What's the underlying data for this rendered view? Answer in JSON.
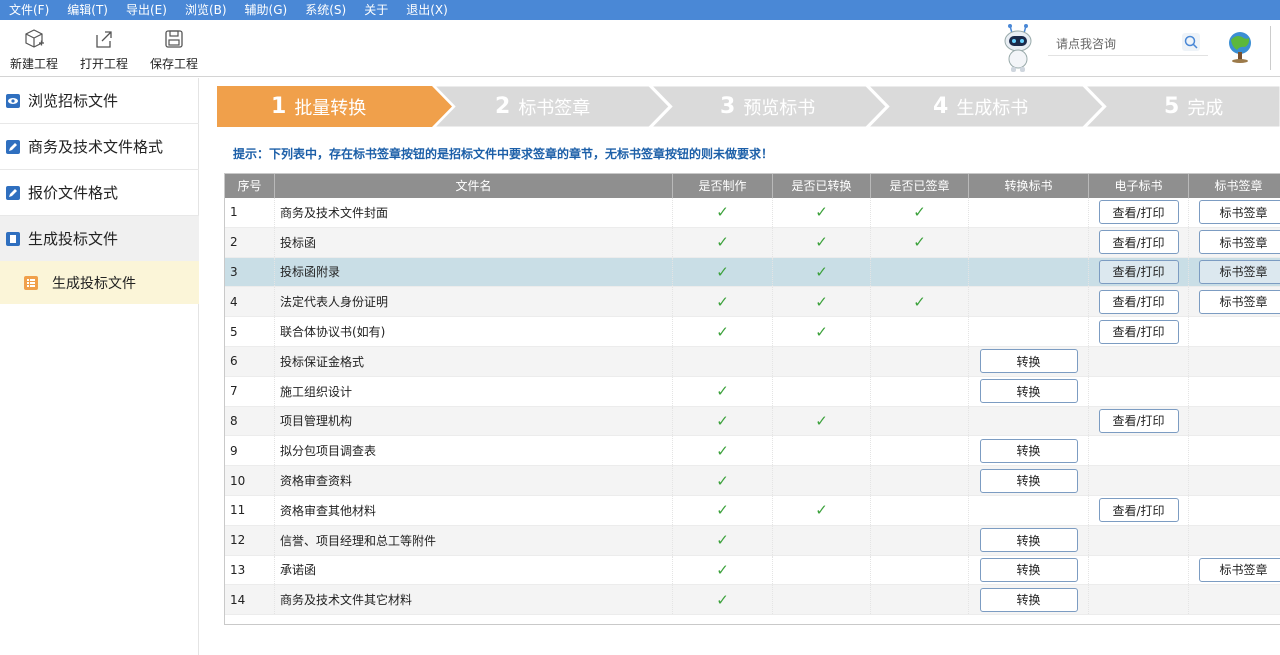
{
  "menu": [
    "文件(F)",
    "编辑(T)",
    "导出(E)",
    "浏览(B)",
    "辅助(G)",
    "系统(S)",
    "关于",
    "退出(X)"
  ],
  "toolbar": {
    "new": "新建工程",
    "open": "打开工程",
    "save": "保存工程"
  },
  "consult": {
    "placeholder": "请点我咨询"
  },
  "sidebar": {
    "items": [
      "浏览招标文件",
      "商务及技术文件格式",
      "报价文件格式",
      "生成投标文件"
    ],
    "sub": "生成投标文件"
  },
  "steps": [
    {
      "num": "1",
      "label": "批量转换"
    },
    {
      "num": "2",
      "label": "标书签章"
    },
    {
      "num": "3",
      "label": "预览标书"
    },
    {
      "num": "4",
      "label": "生成标书"
    },
    {
      "num": "5",
      "label": "完成"
    }
  ],
  "hint": "提示：下列表中，存在标书签章按钮的是招标文件中要求签章的章节，无标书签章按钮的则未做要求！",
  "table": {
    "headers": [
      "序号",
      "文件名",
      "是否制作",
      "是否已转换",
      "是否已签章",
      "转换标书",
      "电子标书",
      "标书签章"
    ],
    "buttons": {
      "convert": "转换",
      "view": "查看/打印",
      "sign": "标书签章"
    },
    "check": "✓",
    "rows": [
      {
        "seq": "1",
        "name": "商务及技术文件封面",
        "made": true,
        "converted": true,
        "signed": true,
        "convert_btn": false,
        "view_btn": true,
        "sign_btn": true
      },
      {
        "seq": "2",
        "name": "投标函",
        "made": true,
        "converted": true,
        "signed": true,
        "convert_btn": false,
        "view_btn": true,
        "sign_btn": true
      },
      {
        "seq": "3",
        "name": "投标函附录",
        "made": true,
        "converted": true,
        "signed": false,
        "convert_btn": false,
        "view_btn": true,
        "sign_btn": true,
        "selected": true
      },
      {
        "seq": "4",
        "name": "法定代表人身份证明",
        "made": true,
        "converted": true,
        "signed": true,
        "convert_btn": false,
        "view_btn": true,
        "sign_btn": true
      },
      {
        "seq": "5",
        "name": "联合体协议书(如有)",
        "made": true,
        "converted": true,
        "signed": false,
        "convert_btn": false,
        "view_btn": true,
        "sign_btn": false
      },
      {
        "seq": "6",
        "name": "投标保证金格式",
        "made": false,
        "converted": false,
        "signed": false,
        "convert_btn": true,
        "view_btn": false,
        "sign_btn": false
      },
      {
        "seq": "7",
        "name": "施工组织设计",
        "made": true,
        "converted": false,
        "signed": false,
        "convert_btn": true,
        "view_btn": false,
        "sign_btn": false
      },
      {
        "seq": "8",
        "name": "项目管理机构",
        "made": true,
        "converted": true,
        "signed": false,
        "convert_btn": false,
        "view_btn": true,
        "sign_btn": false
      },
      {
        "seq": "9",
        "name": "拟分包项目调查表",
        "made": true,
        "converted": false,
        "signed": false,
        "convert_btn": true,
        "view_btn": false,
        "sign_btn": false
      },
      {
        "seq": "10",
        "name": "资格审查资料",
        "made": true,
        "converted": false,
        "signed": false,
        "convert_btn": true,
        "view_btn": false,
        "sign_btn": false
      },
      {
        "seq": "11",
        "name": "资格审查其他材料",
        "made": true,
        "converted": true,
        "signed": false,
        "convert_btn": false,
        "view_btn": true,
        "sign_btn": false
      },
      {
        "seq": "12",
        "name": "信誉、项目经理和总工等附件",
        "made": true,
        "converted": false,
        "signed": false,
        "convert_btn": true,
        "view_btn": false,
        "sign_btn": false
      },
      {
        "seq": "13",
        "name": "承诺函",
        "made": true,
        "converted": false,
        "signed": false,
        "convert_btn": true,
        "view_btn": false,
        "sign_btn": true
      },
      {
        "seq": "14",
        "name": "商务及技术文件其它材料",
        "made": true,
        "converted": false,
        "signed": false,
        "convert_btn": true,
        "view_btn": false,
        "sign_btn": false
      }
    ]
  },
  "colors": {
    "menubar": "#4a88d6",
    "step_active": "#f0a04b",
    "step_inactive": "#d9d9d9",
    "header": "#8f8f8f",
    "check": "#3da23d",
    "hint": "#1c5fa8"
  }
}
